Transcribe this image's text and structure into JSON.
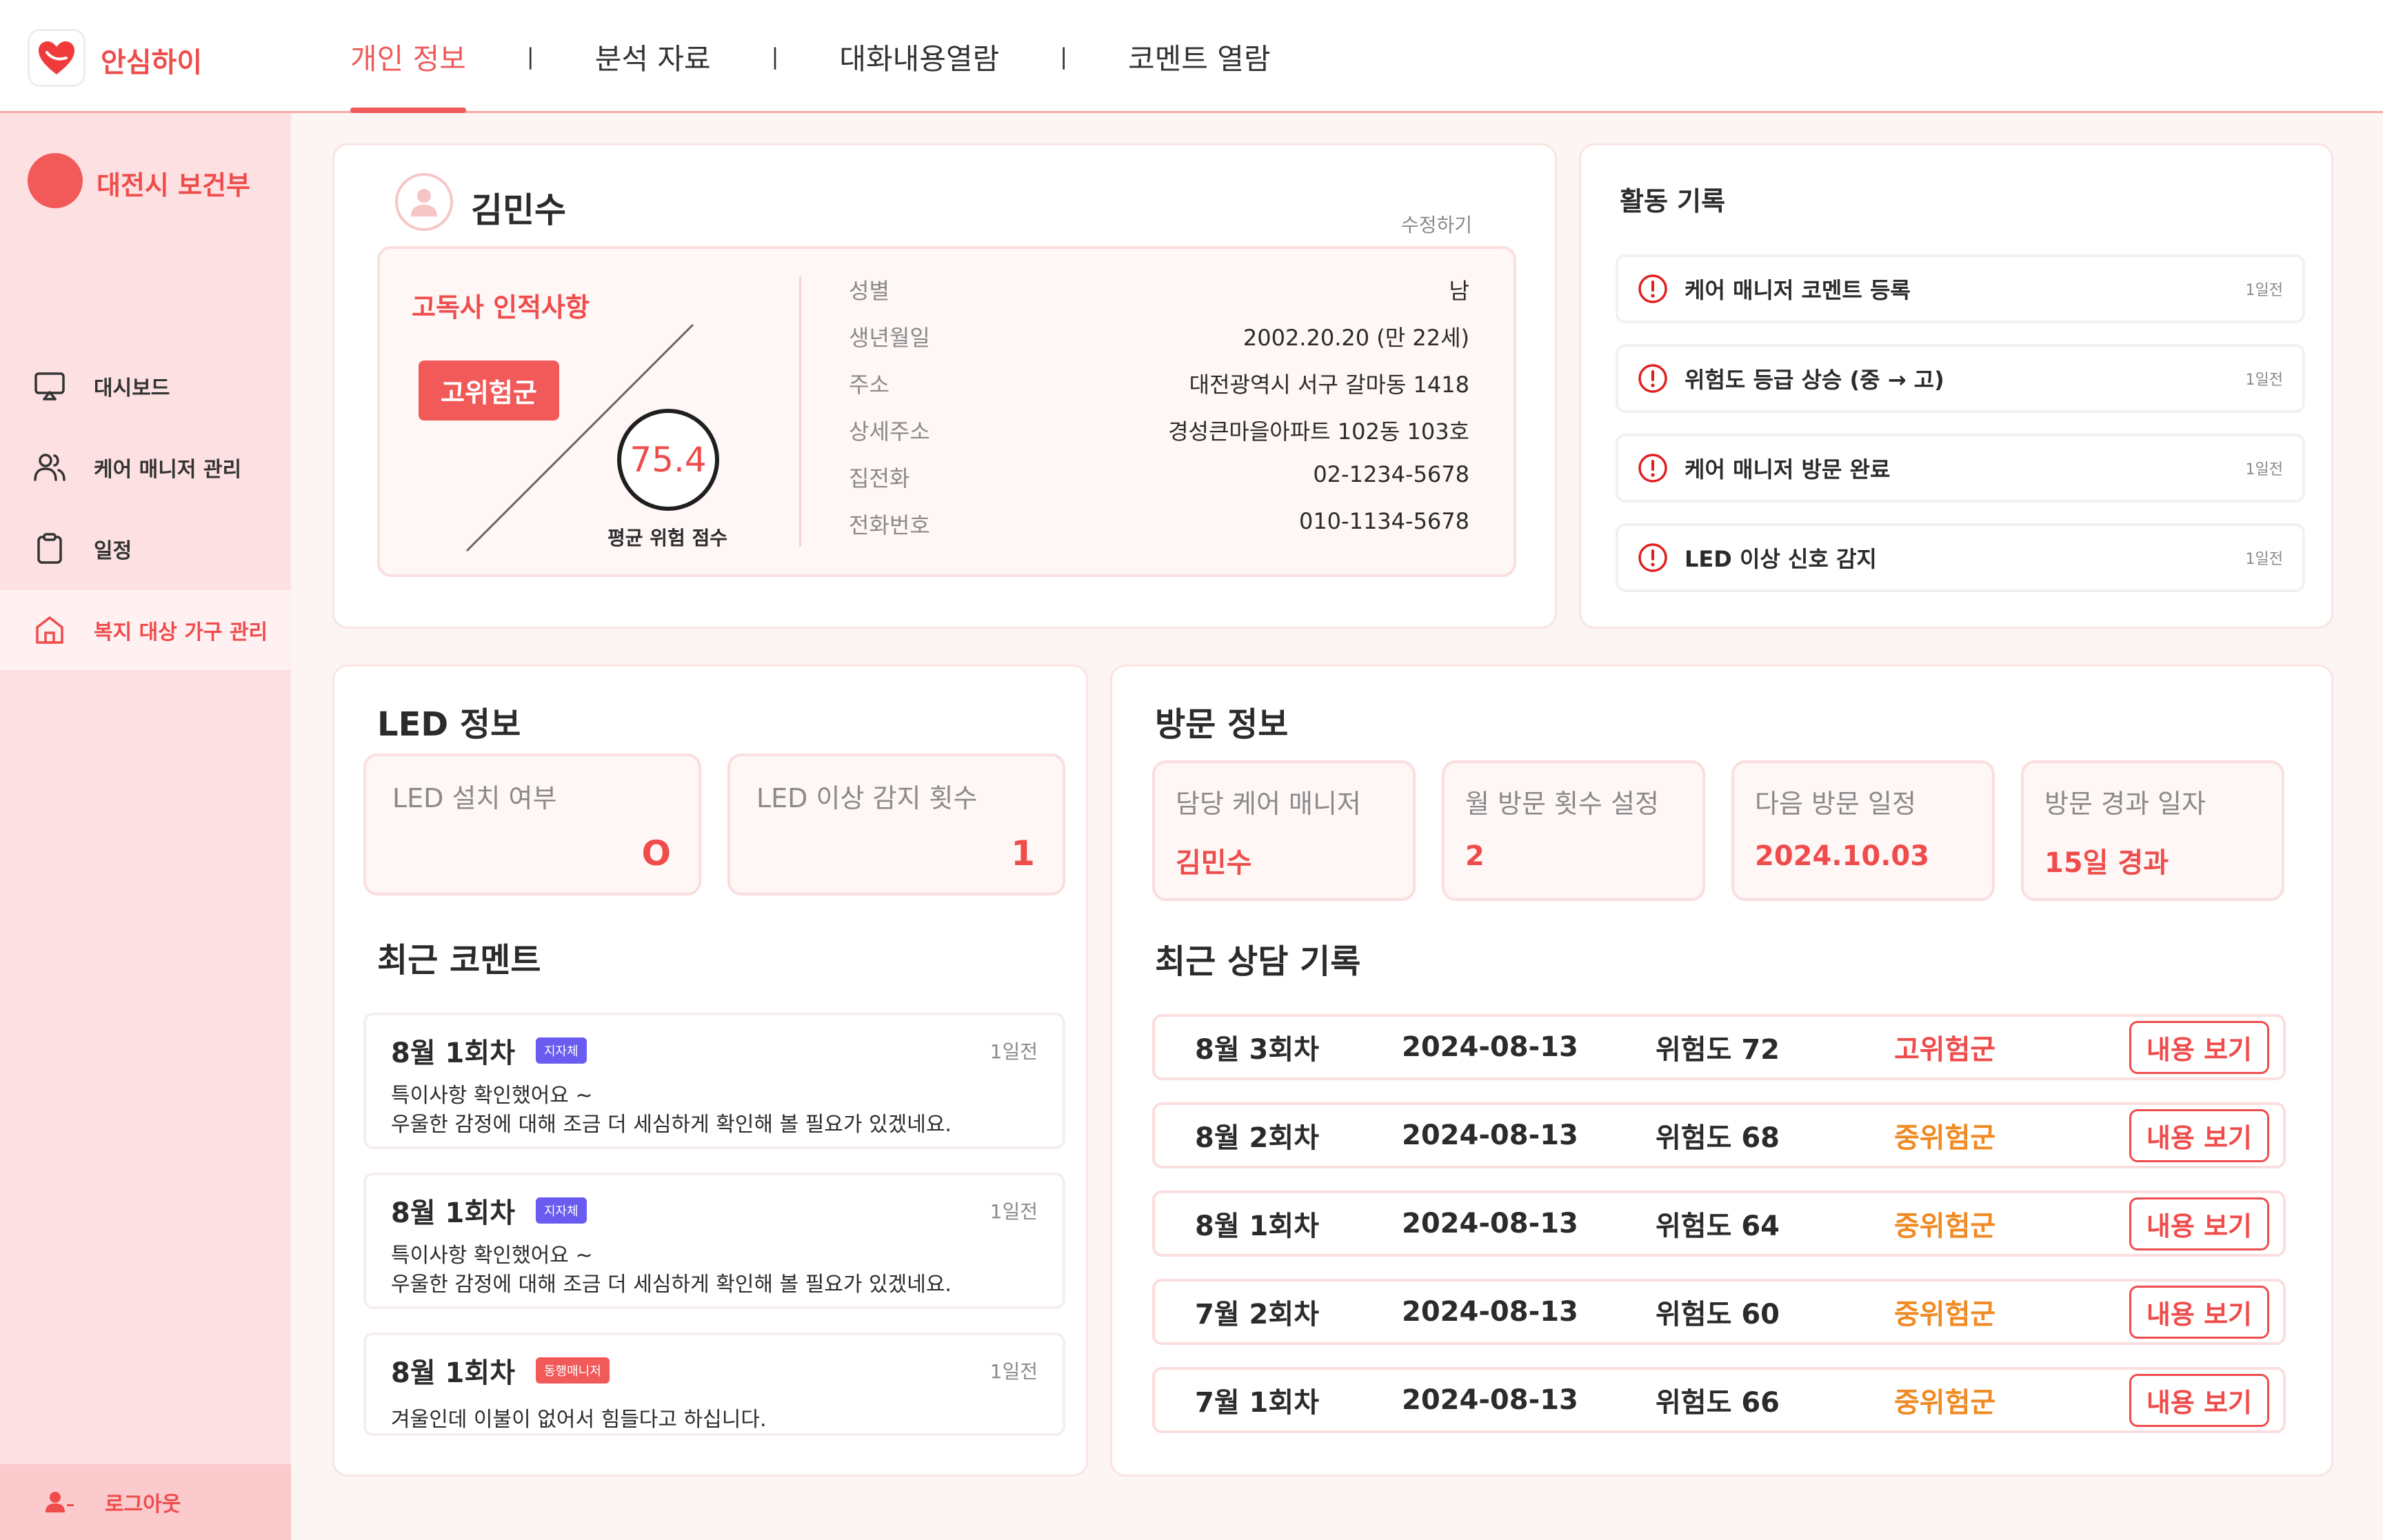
{
  "app": {
    "name": "안심하이",
    "brand_color": "#ef4c4c"
  },
  "tabs": [
    {
      "label": "개인 정보",
      "active": true
    },
    {
      "label": "분석 자료",
      "active": false
    },
    {
      "label": "대화내용열람",
      "active": false
    },
    {
      "label": "코멘트 열람",
      "active": false
    }
  ],
  "tab_separator": "|",
  "sidebar": {
    "org_name": "대전시 보건부",
    "items": [
      {
        "label": "대시보드",
        "icon": "monitor-icon"
      },
      {
        "label": "케어 매니저 관리",
        "icon": "users-icon"
      },
      {
        "label": "일정",
        "icon": "clipboard-icon"
      },
      {
        "label": "복지 대상 가구 관리",
        "icon": "home-icon",
        "active": true
      }
    ],
    "logout_label": "로그아웃"
  },
  "profile": {
    "name": "김민수",
    "edit_label": "수정하기",
    "summary_title": "고독사 인적사항",
    "risk_badge": "고위험군",
    "score": "75.4",
    "score_label": "평균 위험 점수",
    "fields": [
      {
        "label": "성별",
        "value": "남"
      },
      {
        "label": "생년월일",
        "value": "2002.20.20 (만 22세)"
      },
      {
        "label": "주소",
        "value": "대전광역시 서구 갈마동 1418"
      },
      {
        "label": "상세주소",
        "value": "경성큰마을아파트 102동 103호"
      },
      {
        "label": "집전화",
        "value": "02-1234-5678"
      },
      {
        "label": "전화번호",
        "value": "010-1134-5678"
      }
    ]
  },
  "activity": {
    "title": "활동 기록",
    "items": [
      {
        "text": "케어 매니저 코멘트 등록",
        "time": "1일전"
      },
      {
        "text": "위험도 등급 상승 (중 → 고)",
        "time": "1일전"
      },
      {
        "text": "케어 매니저 방문 완료",
        "time": "1일전"
      },
      {
        "text": "LED 이상 신호 감지",
        "time": "1일전"
      }
    ]
  },
  "led": {
    "title": "LED 정보",
    "install_label": "LED 설치 여부",
    "install_value": "O",
    "abnormal_label": "LED 이상 감지 횟수",
    "abnormal_value": "1"
  },
  "comments": {
    "title": "최근 코멘트",
    "items": [
      {
        "round": "8월 1회차",
        "badge": "지자체",
        "badge_color": "#6a5cf0",
        "time": "1일전",
        "lines": [
          "특이사항 확인했어요 ~",
          "우울한 감정에 대해 조금 더 세심하게 확인해 볼 필요가 있겠네요."
        ]
      },
      {
        "round": "8월 1회차",
        "badge": "지자체",
        "badge_color": "#6a5cf0",
        "time": "1일전",
        "lines": [
          "특이사항 확인했어요 ~",
          "우울한 감정에 대해 조금 더 세심하게 확인해 볼 필요가 있겠네요."
        ]
      },
      {
        "round": "8월 1회차",
        "badge": "동행매니저",
        "badge_color": "#f25a5a",
        "time": "1일전",
        "lines": [
          "겨울인데 이불이 없어서 힘들다고 하십니다.",
          ""
        ]
      }
    ]
  },
  "visit": {
    "title": "방문 정보",
    "boxes": [
      {
        "label": "담당 케어 매니저",
        "value": "김민수"
      },
      {
        "label": "월 방문 횟수 설정",
        "value": "2"
      },
      {
        "label": "다음 방문 일정",
        "value": "2024.10.03"
      },
      {
        "label": "방문 경과 일자",
        "value": "15일 경과"
      }
    ]
  },
  "consult": {
    "title": "최근 상담 기록",
    "view_label": "내용 보기",
    "rows": [
      {
        "round": "8월 3회차",
        "date": "2024-08-13",
        "risk": "위험도 72",
        "level": "고위험군",
        "level_color": "#ef4c4c"
      },
      {
        "round": "8월 2회차",
        "date": "2024-08-13",
        "risk": "위험도 68",
        "level": "중위험군",
        "level_color": "#f08a24"
      },
      {
        "round": "8월 1회차",
        "date": "2024-08-13",
        "risk": "위험도 64",
        "level": "중위험군",
        "level_color": "#f08a24"
      },
      {
        "round": "7월 2회차",
        "date": "2024-08-13",
        "risk": "위험도 60",
        "level": "중위험군",
        "level_color": "#f08a24"
      },
      {
        "round": "7월 1회차",
        "date": "2024-08-13",
        "risk": "위험도 66",
        "level": "중위험군",
        "level_color": "#f08a24"
      }
    ]
  }
}
